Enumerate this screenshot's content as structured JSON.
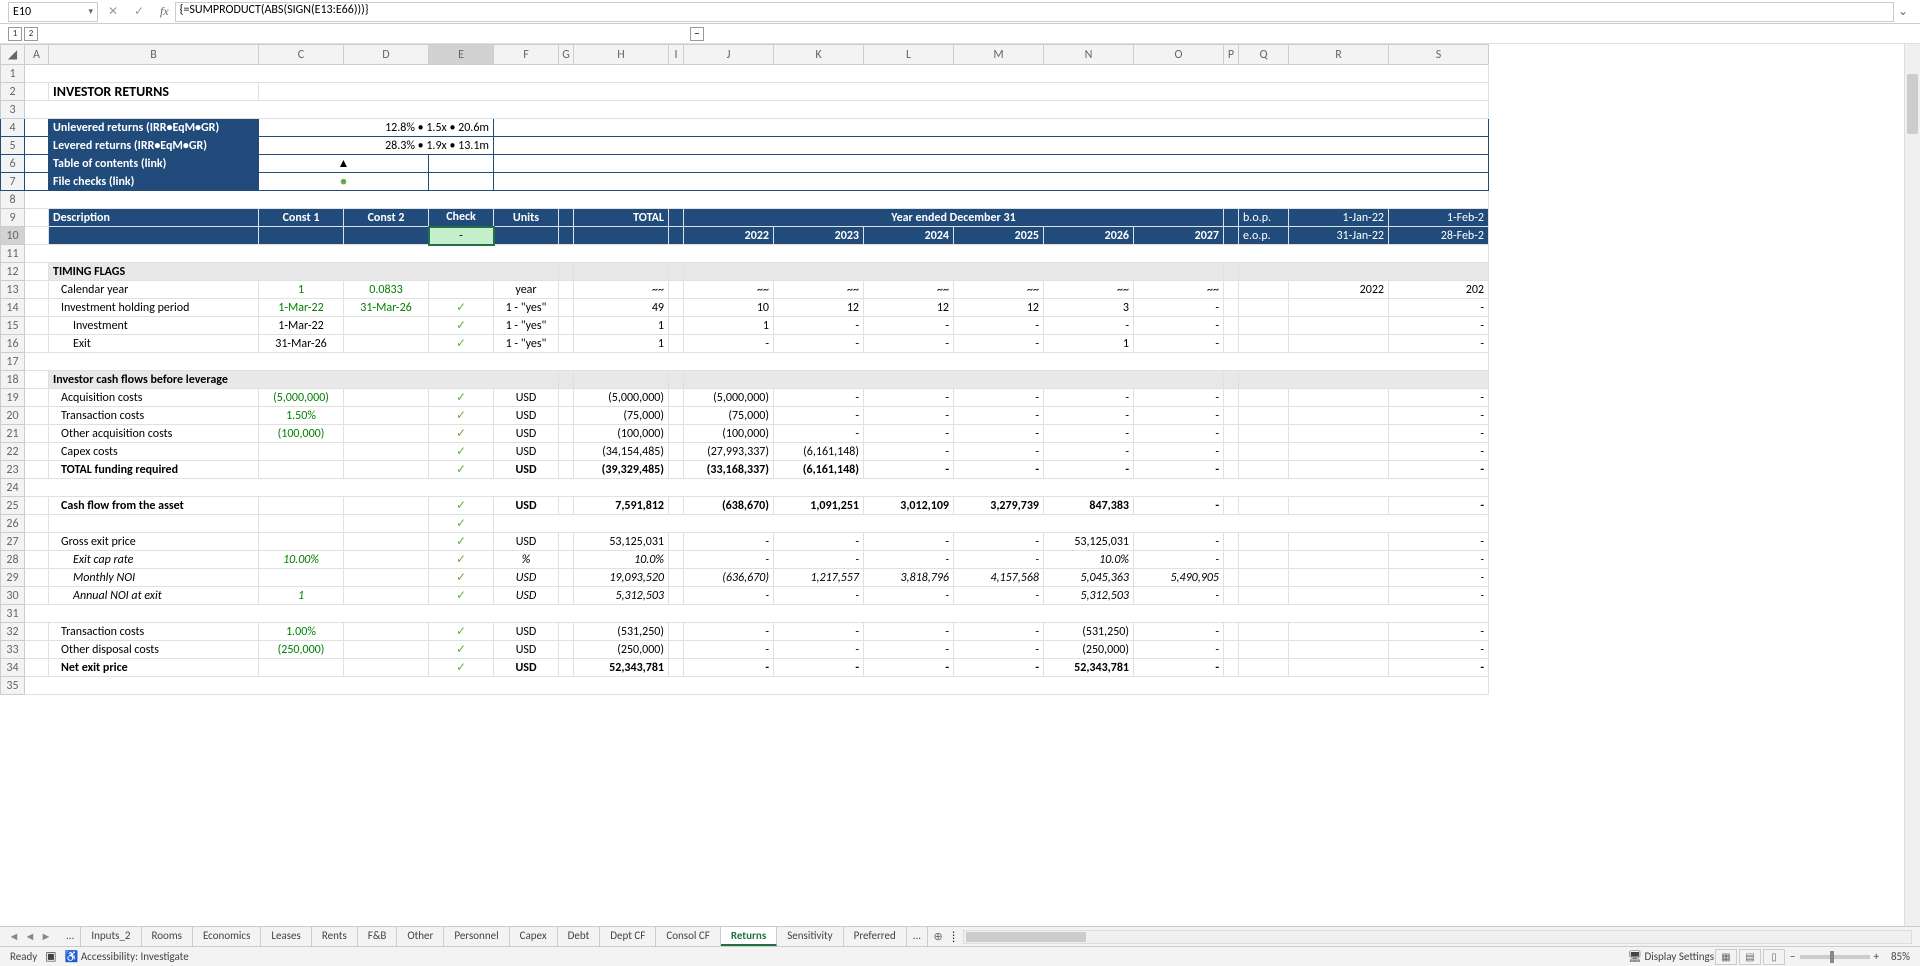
{
  "activeCell": "E10",
  "formula": "{=SUMPRODUCT(ABS(SIGN(E13:E66)))}",
  "formulaLabel": "fx",
  "outlineLevels": [
    "1",
    "2"
  ],
  "outlineCollapse": "−",
  "columns": [
    "A",
    "B",
    "C",
    "D",
    "E",
    "F",
    "G",
    "H",
    "I",
    "J",
    "K",
    "L",
    "M",
    "N",
    "O",
    "P",
    "Q",
    "R",
    "S"
  ],
  "title": "INVESTOR RETURNS",
  "kpi": {
    "unleveredLabel": "Unlevered returns (IRR•EqM•GR)",
    "unleveredVal": "12.8% • 1.5x • 20.6m",
    "leveredLabel": "Levered returns (IRR•EqM•GR)",
    "leveredVal": "28.3% • 1.9x • 13.1m",
    "tocLabel": "Table of contents (link)",
    "tocSym": "▲",
    "fileChecksLabel": "File checks (link)",
    "fileChecksSym": "●"
  },
  "hdr": {
    "desc": "Description",
    "c1": "Const 1",
    "c2": "Const 2",
    "check": "Check",
    "units": "Units",
    "total": "TOTAL",
    "yearEnded": "Year ended December 31",
    "bop": "b.o.p.",
    "bopv": "1-Jan-22",
    "bopv2": "1-Feb-2",
    "eop": "e.o.p.",
    "eopv": "31-Jan-22",
    "eopv2": "28-Feb-2",
    "y": [
      "2022",
      "2023",
      "2024",
      "2025",
      "2026",
      "2027"
    ]
  },
  "eCellText": "-",
  "sec": {
    "timing": "TIMING FLAGS",
    "icf": "Investor cash flows before leverage"
  },
  "rows": {
    "r13": {
      "desc": "Calendar year",
      "c1": "1",
      "c2": "0.0833",
      "units": "year",
      "total": "~~",
      "y": [
        "~~",
        "~~",
        "~~",
        "~~",
        "~~",
        "~~"
      ],
      "r": "2022",
      "s": "202"
    },
    "r14": {
      "desc": "Investment holding period",
      "c1": "1-Mar-22",
      "c2": "31-Mar-26",
      "chk": "✓",
      "units": "1 - \"yes\"",
      "total": "49",
      "y": [
        "10",
        "12",
        "12",
        "12",
        "3",
        "-"
      ],
      "r": "",
      "s": "-"
    },
    "r15": {
      "desc": "Investment",
      "c1": "1-Mar-22",
      "chk": "✓",
      "units": "1 - \"yes\"",
      "total": "1",
      "y": [
        "1",
        "-",
        "-",
        "-",
        "-",
        "-"
      ],
      "s": "-"
    },
    "r16": {
      "desc": "Exit",
      "c1": "31-Mar-26",
      "chk": "✓",
      "units": "1 - \"yes\"",
      "total": "1",
      "y": [
        "-",
        "-",
        "-",
        "-",
        "1",
        "-"
      ],
      "s": "-"
    },
    "r19": {
      "desc": "Acquisition costs",
      "c1": "(5,000,000)",
      "chk": "✓",
      "units": "USD",
      "total": "(5,000,000)",
      "y": [
        "(5,000,000)",
        "-",
        "-",
        "-",
        "-",
        "-"
      ],
      "s": "-"
    },
    "r20": {
      "desc": "Transaction costs",
      "c1": "1.50%",
      "chk": "✓",
      "units": "USD",
      "total": "(75,000)",
      "y": [
        "(75,000)",
        "-",
        "-",
        "-",
        "-",
        "-"
      ],
      "s": "-"
    },
    "r21": {
      "desc": "Other acquisition costs",
      "c1": "(100,000)",
      "chk": "✓",
      "units": "USD",
      "total": "(100,000)",
      "y": [
        "(100,000)",
        "-",
        "-",
        "-",
        "-",
        "-"
      ],
      "s": "-"
    },
    "r22": {
      "desc": "Capex costs",
      "chk": "✓",
      "units": "USD",
      "total": "(34,154,485)",
      "y": [
        "(27,993,337)",
        "(6,161,148)",
        "-",
        "-",
        "-",
        "-"
      ],
      "s": "-"
    },
    "r23": {
      "desc": "TOTAL funding required",
      "chk": "✓",
      "units": "USD",
      "total": "(39,329,485)",
      "y": [
        "(33,168,337)",
        "(6,161,148)",
        "-",
        "-",
        "-",
        "-"
      ],
      "s": "-"
    },
    "r25": {
      "desc": "Cash flow from the asset",
      "chk": "✓",
      "units": "USD",
      "total": "7,591,812",
      "y": [
        "(638,670)",
        "1,091,251",
        "3,012,109",
        "3,279,739",
        "847,383",
        "-"
      ],
      "s": "-"
    },
    "r26": {
      "chk": "✓"
    },
    "r27": {
      "desc": "Gross exit price",
      "chk": "✓",
      "units": "USD",
      "total": "53,125,031",
      "y": [
        "-",
        "-",
        "-",
        "-",
        "53,125,031",
        "-"
      ],
      "s": "-"
    },
    "r28": {
      "desc": "Exit cap rate",
      "c1": "10.00%",
      "chk": "✓",
      "units": "%",
      "total": "10.0%",
      "y": [
        "-",
        "-",
        "-",
        "-",
        "10.0%",
        "-"
      ],
      "s": "-"
    },
    "r29": {
      "desc": "Monthly NOI",
      "chk": "✓",
      "units": "USD",
      "total": "19,093,520",
      "y": [
        "(636,670)",
        "1,217,557",
        "3,818,796",
        "4,157,568",
        "5,045,363",
        "5,490,905"
      ],
      "s": "-"
    },
    "r30": {
      "desc": "Annual NOI at exit",
      "c1": "1",
      "chk": "✓",
      "units": "USD",
      "total": "5,312,503",
      "y": [
        "-",
        "-",
        "-",
        "-",
        "5,312,503",
        "-"
      ],
      "s": "-"
    },
    "r32": {
      "desc": "Transaction costs",
      "c1": "1.00%",
      "chk": "✓",
      "units": "USD",
      "total": "(531,250)",
      "y": [
        "-",
        "-",
        "-",
        "-",
        "(531,250)",
        "-"
      ],
      "s": "-"
    },
    "r33": {
      "desc": "Other disposal costs",
      "c1": "(250,000)",
      "chk": "✓",
      "units": "USD",
      "total": "(250,000)",
      "y": [
        "-",
        "-",
        "-",
        "-",
        "(250,000)",
        "-"
      ],
      "s": "-"
    },
    "r34": {
      "desc": "Net exit price",
      "chk": "✓",
      "units": "USD",
      "total": "52,343,781",
      "y": [
        "-",
        "-",
        "-",
        "-",
        "52,343,781",
        "-"
      ],
      "s": "-"
    }
  },
  "tabs": [
    "...",
    "Inputs_2",
    "Rooms",
    "Economics",
    "Leases",
    "Rents",
    "F&B",
    "Other",
    "Personnel",
    "Capex",
    "Debt",
    "Dept CF",
    "Consol CF",
    "Returns",
    "Sensitivity",
    "Preferred",
    "..."
  ],
  "activeTab": "Returns",
  "status": {
    "ready": "Ready",
    "acc": "Accessibility: Investigate",
    "ds": "Display Settings",
    "zoom": "85%"
  }
}
